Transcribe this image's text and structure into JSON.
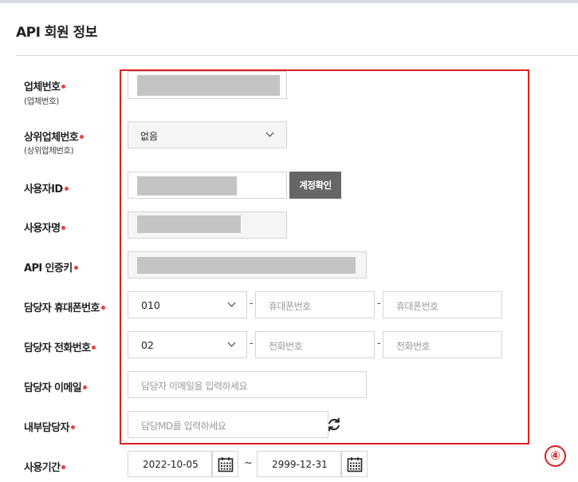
{
  "page_title": "API 회원 정보",
  "fields": {
    "company_no": {
      "label": "업체번호",
      "sub": "(업체번호)"
    },
    "parent_company_no": {
      "label": "상위업체번호",
      "sub": "(상위업체번호)",
      "value": "없음"
    },
    "user_id": {
      "label": "사용자ID",
      "button": "계정확인"
    },
    "user_name": {
      "label": "사용자명"
    },
    "api_key": {
      "label": "API 인증키"
    },
    "mobile": {
      "label": "담당자 휴대폰번호",
      "prefix": "010",
      "placeholder_mid": "휴대폰번호",
      "placeholder_last": "휴대폰번호"
    },
    "phone": {
      "label": "담당자 전화번호",
      "prefix": "02",
      "placeholder_mid": "전화번호",
      "placeholder_last": "전화번호"
    },
    "email": {
      "label": "담당자 이메일",
      "placeholder": "담당자 이메일을 입력하세요"
    },
    "internal_manager": {
      "label": "내부담당자",
      "placeholder": "담당MD를 입력하세요"
    },
    "period": {
      "label": "사용기간",
      "start": "2022-10-05",
      "separator": "~",
      "end": "2999-12-31"
    }
  },
  "annotation": {
    "number": "④"
  },
  "colors": {
    "required_dot": "#e8423f",
    "highlight_border": "#e01e1e",
    "button_dark": "#666666"
  }
}
